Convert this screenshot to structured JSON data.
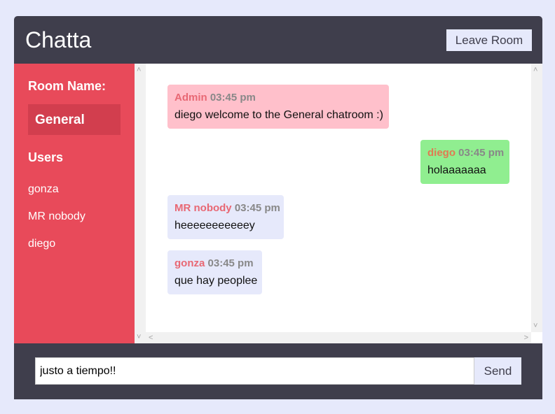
{
  "app": {
    "title": "Chatta"
  },
  "header": {
    "leave_label": "Leave Room"
  },
  "sidebar": {
    "room_label": "Room Name:",
    "room_name": "General",
    "users_label": "Users",
    "users": [
      "gonza",
      "MR nobody",
      "diego"
    ]
  },
  "messages": [
    {
      "user": "Admin",
      "time": "03:45 pm",
      "text": "diego welcome to the General chatroom :)",
      "color": "#ffc0cb"
    },
    {
      "user": "diego",
      "time": "03:45 pm",
      "text": "holaaaaaaa",
      "color": "#90ee90"
    },
    {
      "user": "MR nobody",
      "time": "03:45 pm",
      "text": "heeeeeeeeeeey",
      "color": "#e6e9fb"
    },
    {
      "user": "gonza",
      "time": "03:45 pm",
      "text": "que hay peoplee",
      "color": "#e6e9fb"
    }
  ],
  "footer": {
    "input_value": "justo a tiempo!!",
    "send_label": "Send"
  },
  "colors": {
    "background": "#e6e9fb",
    "header": "#3f3e4c",
    "sidebar": "#e84a5a",
    "room_highlight": "#d23e4e"
  }
}
